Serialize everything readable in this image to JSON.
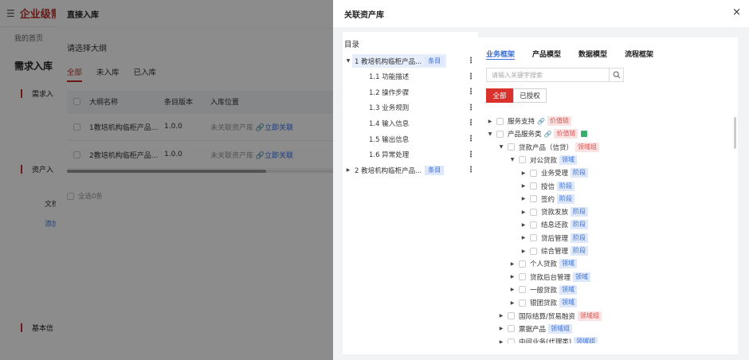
{
  "bg": {
    "logo": "企业级需",
    "crumb": "我的首页",
    "title": "需求入库",
    "sections": [
      "需求入",
      "资产入",
      "基本信"
    ],
    "doc_label": "文档",
    "doc_link": "添加"
  },
  "modal": {
    "title": "直接入库",
    "subtitle": "请选择大纲",
    "tabs": [
      "全部",
      "未入库",
      "已入库"
    ],
    "columns": [
      "大纲名称",
      "条目版本",
      "入库位置"
    ],
    "rows": [
      {
        "name": "1教培机构临柜产品...",
        "version": "1.0.0",
        "status": "未关联资产库",
        "link": "🔗立即关联"
      },
      {
        "name": "2教培机构临柜产品...",
        "version": "1.0.0",
        "status": "未关联资产库",
        "link": "🔗立即关联"
      }
    ],
    "select_all": "全选0条"
  },
  "drawer": {
    "title": "关联资产库",
    "close": "×",
    "catalog": {
      "title": "目录",
      "items": [
        {
          "label": "1 教培机构临柜产品...",
          "tag": "条目",
          "caret": "▼",
          "indent": 0,
          "selected": true
        },
        {
          "label": "1.1 功能描述",
          "tag": "",
          "caret": "",
          "indent": 1,
          "selected": false
        },
        {
          "label": "1.2 操作步骤",
          "tag": "",
          "caret": "",
          "indent": 1,
          "selected": false
        },
        {
          "label": "1.3 业务规则",
          "tag": "",
          "caret": "",
          "indent": 1,
          "selected": false
        },
        {
          "label": "1.4 输入信息",
          "tag": "",
          "caret": "",
          "indent": 1,
          "selected": false
        },
        {
          "label": "1.5 输出信息",
          "tag": "",
          "caret": "",
          "indent": 1,
          "selected": false
        },
        {
          "label": "1.6 异常处理",
          "tag": "",
          "caret": "",
          "indent": 1,
          "selected": false
        },
        {
          "label": "2 教培机构临柜产品...",
          "tag": "条目",
          "caret": "▶",
          "indent": 0,
          "selected": false
        }
      ]
    },
    "panel": {
      "tabs": [
        "业务框架",
        "产品模型",
        "数据模型",
        "流程框架"
      ],
      "search_placeholder": "请输入关键字搜索",
      "btn_all": "全部",
      "btn_auth": "已授权",
      "tree": [
        {
          "label": "服务支持",
          "tag": "价值链",
          "tagType": "red",
          "link": true,
          "green": false,
          "level": 0,
          "caret": "▶"
        },
        {
          "label": "产品服务类",
          "tag": "价值链",
          "tagType": "red",
          "link": true,
          "green": true,
          "level": 0,
          "caret": "▼"
        },
        {
          "label": "贷款产品（信贷）",
          "tag": "领域组",
          "tagType": "red",
          "link": false,
          "green": false,
          "level": 1,
          "caret": "▼"
        },
        {
          "label": "对公贷款",
          "tag": "领域",
          "tagType": "blue",
          "link": false,
          "green": false,
          "level": 2,
          "caret": "▼"
        },
        {
          "label": "业务受理",
          "tag": "阶段",
          "tagType": "blue",
          "link": false,
          "green": false,
          "level": 3,
          "caret": "▶"
        },
        {
          "label": "授信",
          "tag": "阶段",
          "tagType": "blue",
          "link": false,
          "green": false,
          "level": 3,
          "caret": "▶"
        },
        {
          "label": "签约",
          "tag": "阶段",
          "tagType": "blue",
          "link": false,
          "green": false,
          "level": 3,
          "caret": "▶"
        },
        {
          "label": "贷款发放",
          "tag": "阶段",
          "tagType": "blue",
          "link": false,
          "green": false,
          "level": 3,
          "caret": "▶"
        },
        {
          "label": "结息还款",
          "tag": "阶段",
          "tagType": "blue",
          "link": false,
          "green": false,
          "level": 3,
          "caret": "▶"
        },
        {
          "label": "贷后管理",
          "tag": "阶段",
          "tagType": "blue",
          "link": false,
          "green": false,
          "level": 3,
          "caret": "▶"
        },
        {
          "label": "综合管理",
          "tag": "阶段",
          "tagType": "blue",
          "link": false,
          "green": false,
          "level": 3,
          "caret": "▶"
        },
        {
          "label": "个人贷款",
          "tag": "领域",
          "tagType": "blue",
          "link": false,
          "green": false,
          "level": 2,
          "caret": "▶"
        },
        {
          "label": "贷款后台管理",
          "tag": "领域",
          "tagType": "blue",
          "link": false,
          "green": false,
          "level": 2,
          "caret": "▶"
        },
        {
          "label": "一般贷款",
          "tag": "领域",
          "tagType": "blue",
          "link": false,
          "green": false,
          "level": 2,
          "caret": "▶"
        },
        {
          "label": "银团贷款",
          "tag": "领域",
          "tagType": "blue",
          "link": false,
          "green": false,
          "level": 2,
          "caret": "▶"
        },
        {
          "label": "国际结算/贸易融资",
          "tag": "领域组",
          "tagType": "red",
          "link": false,
          "green": false,
          "level": 1,
          "caret": "▶"
        },
        {
          "label": "票据产品",
          "tag": "领域组",
          "tagType": "blue",
          "link": false,
          "green": false,
          "level": 1,
          "caret": "▶"
        },
        {
          "label": "中间业务(代理类)",
          "tag": "领域组",
          "tagType": "blue",
          "link": false,
          "green": false,
          "level": 1,
          "caret": "▶"
        }
      ]
    }
  },
  "colors": {
    "accent_red": "#d9312b",
    "link_blue": "#3b6fd6"
  }
}
